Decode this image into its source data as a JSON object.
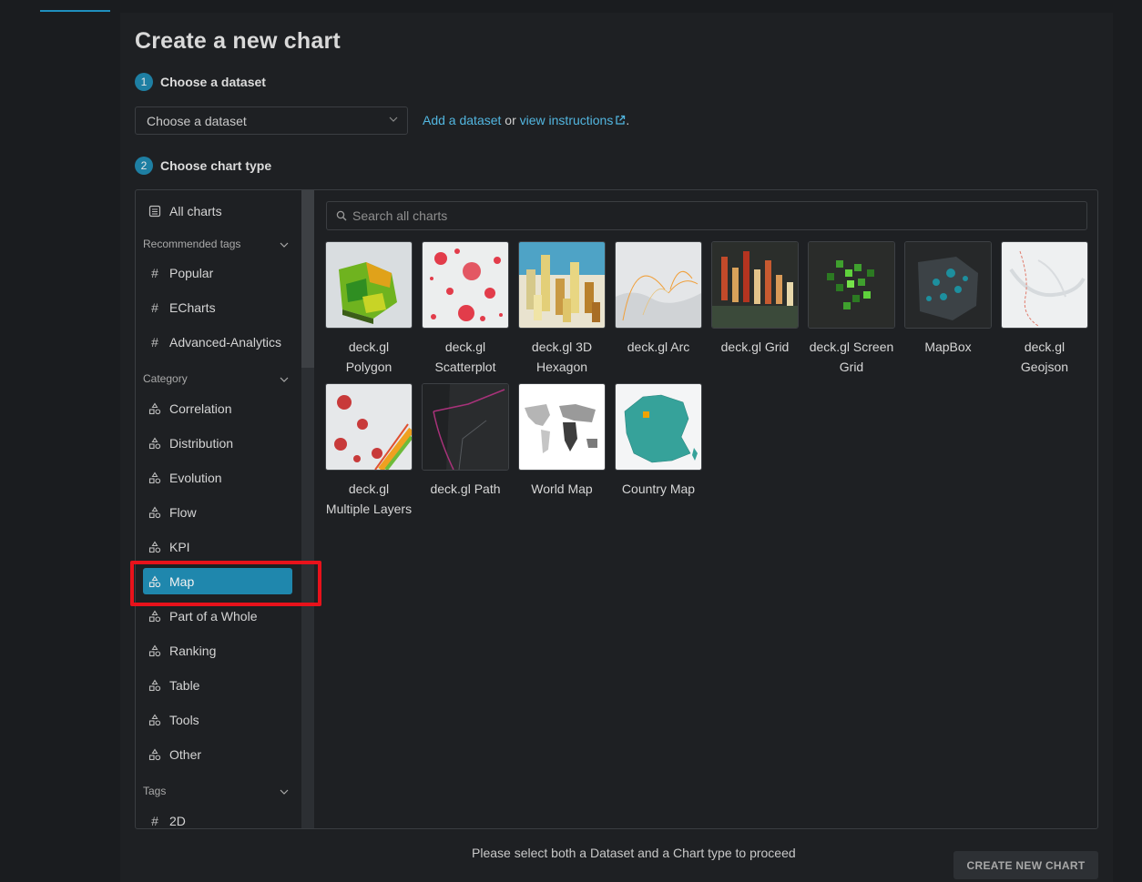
{
  "page_title": "Create a new chart",
  "steps": {
    "dataset": {
      "number": "1",
      "label": "Choose a dataset"
    },
    "chart_type": {
      "number": "2",
      "label": "Choose chart type"
    }
  },
  "dataset_select": {
    "placeholder": "Choose a dataset"
  },
  "dataset_help": {
    "add_link": "Add a dataset",
    "or_text": " or ",
    "instructions_link": "view instructions",
    "period": "."
  },
  "sidebar": {
    "all_charts": "All charts",
    "recommended_header": "Recommended tags",
    "recommended": [
      "Popular",
      "ECharts",
      "Advanced-Analytics"
    ],
    "category_header": "Category",
    "categories": [
      "Correlation",
      "Distribution",
      "Evolution",
      "Flow",
      "KPI",
      "Map",
      "Part of a Whole",
      "Ranking",
      "Table",
      "Tools",
      "Other"
    ],
    "selected_category": "Map",
    "tags_header": "Tags",
    "tags": [
      "2D"
    ]
  },
  "search": {
    "placeholder": "Search all charts"
  },
  "charts": [
    {
      "name": "deck.gl Polygon",
      "thumb": "polygon"
    },
    {
      "name": "deck.gl Scatterplot",
      "thumb": "scatter"
    },
    {
      "name": "deck.gl 3D Hexagon",
      "thumb": "hexagon"
    },
    {
      "name": "deck.gl Arc",
      "thumb": "arc"
    },
    {
      "name": "deck.gl Grid",
      "thumb": "grid"
    },
    {
      "name": "deck.gl Screen Grid",
      "thumb": "screengrid"
    },
    {
      "name": "MapBox",
      "thumb": "mapbox"
    },
    {
      "name": "deck.gl Geojson",
      "thumb": "geojson"
    },
    {
      "name": "deck.gl Multiple Layers",
      "thumb": "multi"
    },
    {
      "name": "deck.gl Path",
      "thumb": "path"
    },
    {
      "name": "World Map",
      "thumb": "world"
    },
    {
      "name": "Country Map",
      "thumb": "country"
    }
  ],
  "footer": {
    "message": "Please select both a Dataset and a Chart type to proceed",
    "create_button": "CREATE NEW CHART"
  },
  "colors": {
    "accent": "#1f87ad",
    "link": "#52b6e0",
    "highlight": "#e8121b"
  }
}
